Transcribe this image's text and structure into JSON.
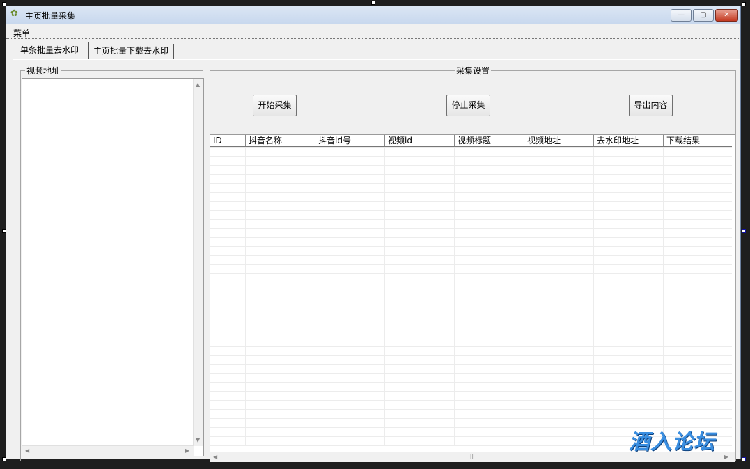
{
  "window": {
    "title": "主页批量采集",
    "icon": "app-icon-flower"
  },
  "title_controls": {
    "min": "—",
    "max": "▢",
    "close": "✕"
  },
  "menu": {
    "items": [
      {
        "label": "菜单"
      }
    ]
  },
  "tabs": [
    {
      "label": "单条批量去水印",
      "active": true
    },
    {
      "label": "主页批量下载去水印",
      "active": false
    }
  ],
  "left_group": {
    "label": "视频地址"
  },
  "right_group": {
    "label": "采集设置"
  },
  "buttons": {
    "start": "开始采集",
    "stop": "停止采集",
    "export": "导出内容"
  },
  "table": {
    "columns": [
      {
        "label": "ID"
      },
      {
        "label": "抖音名称"
      },
      {
        "label": "抖音id号"
      },
      {
        "label": "视频id"
      },
      {
        "label": "视频标题"
      },
      {
        "label": "视频地址"
      },
      {
        "label": "去水印地址"
      },
      {
        "label": "下载结果"
      }
    ],
    "rows": []
  },
  "scroll_glyphs": {
    "up": "▲",
    "down": "▼",
    "left": "◀",
    "right": "▶",
    "grip": "|||"
  },
  "watermark": {
    "text": "酒入论坛",
    "color": "#3a8ee0"
  }
}
